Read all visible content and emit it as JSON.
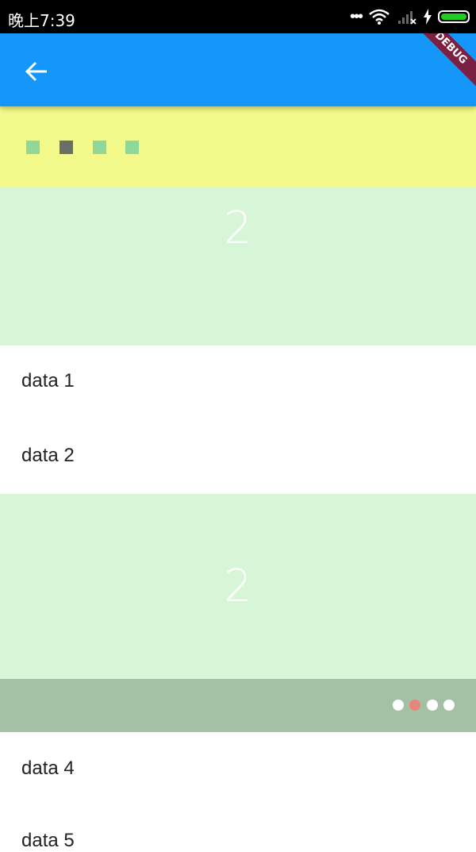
{
  "status_bar": {
    "time": "晚上7:39",
    "background": "#000000",
    "battery_color": "#22cc22"
  },
  "app_bar": {
    "background": "#1496fa",
    "back_icon": "arrow-left-icon",
    "debug_label": "DEBUG",
    "debug_color": "#7a2040"
  },
  "yellow_strip": {
    "background": "#f3f98b",
    "squares": [
      "#8fd89c",
      "#6a6e68",
      "#8fd89c",
      "#8fd89c"
    ]
  },
  "banner_top": {
    "text": "2",
    "background": "#d7f6d7"
  },
  "list_a": [
    "data 1",
    "data 2"
  ],
  "banner_mid": {
    "text": "2",
    "background": "#d7f6d7"
  },
  "indicator": {
    "background": "#a4c1a5",
    "dots": [
      "#ffffff",
      "#e8857a",
      "#ffffff",
      "#ffffff"
    ]
  },
  "list_b": [
    "data 4",
    "data 5"
  ]
}
